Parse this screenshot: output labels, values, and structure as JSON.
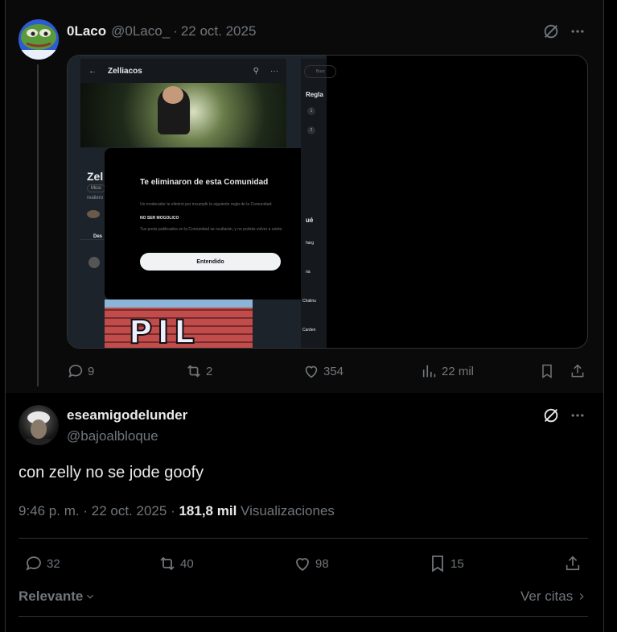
{
  "reply": {
    "name": "0Laco",
    "handle": "@0Laco_",
    "dot": "·",
    "date": "22 oct. 2025",
    "stats": {
      "replies": "9",
      "reposts": "2",
      "likes": "354",
      "views": "22 mil"
    },
    "image": {
      "community_name": "Zelliacos",
      "search_placeholder": "Busc",
      "rules_header": "Regla",
      "partial_title": "Zel",
      "partial_chip": "Músi",
      "partial_desc": "realiero",
      "partial_tab": "Des",
      "right_section": "ué",
      "right_items": [
        "harg",
        "ria",
        "Chalinu",
        "Carden"
      ],
      "right_numbers": [
        "1",
        "2"
      ],
      "modal": {
        "title": "Te eliminaron de esta Comunidad",
        "body": "Un moderador te eliminó por incumplir la siguiente regla de la Comunidad:",
        "rule": "NO SER MOGOLICO",
        "note": "Tus posts publicados en la Comunidad se ocultarán, y no podrás volver a unirte.",
        "button": "Entendido"
      },
      "graffiti_text": "PIL"
    }
  },
  "main": {
    "name": "eseamigodelunder",
    "handle": "@bajoalbloque",
    "text": "con zelly no se jode goofy",
    "time": "9:46 p. m.",
    "dot": "·",
    "date": "22 oct. 2025",
    "dot2": "·",
    "views_count": "181,8 mil",
    "views_label": "Visualizaciones",
    "stats": {
      "replies": "32",
      "reposts": "40",
      "likes": "98",
      "bookmarks": "15"
    }
  },
  "footer": {
    "sort": "Relevante",
    "quotes": "Ver citas"
  },
  "colors": {
    "background": "#000000",
    "text": "#e7e9ea",
    "muted": "#71767b",
    "border": "#2f3336"
  }
}
